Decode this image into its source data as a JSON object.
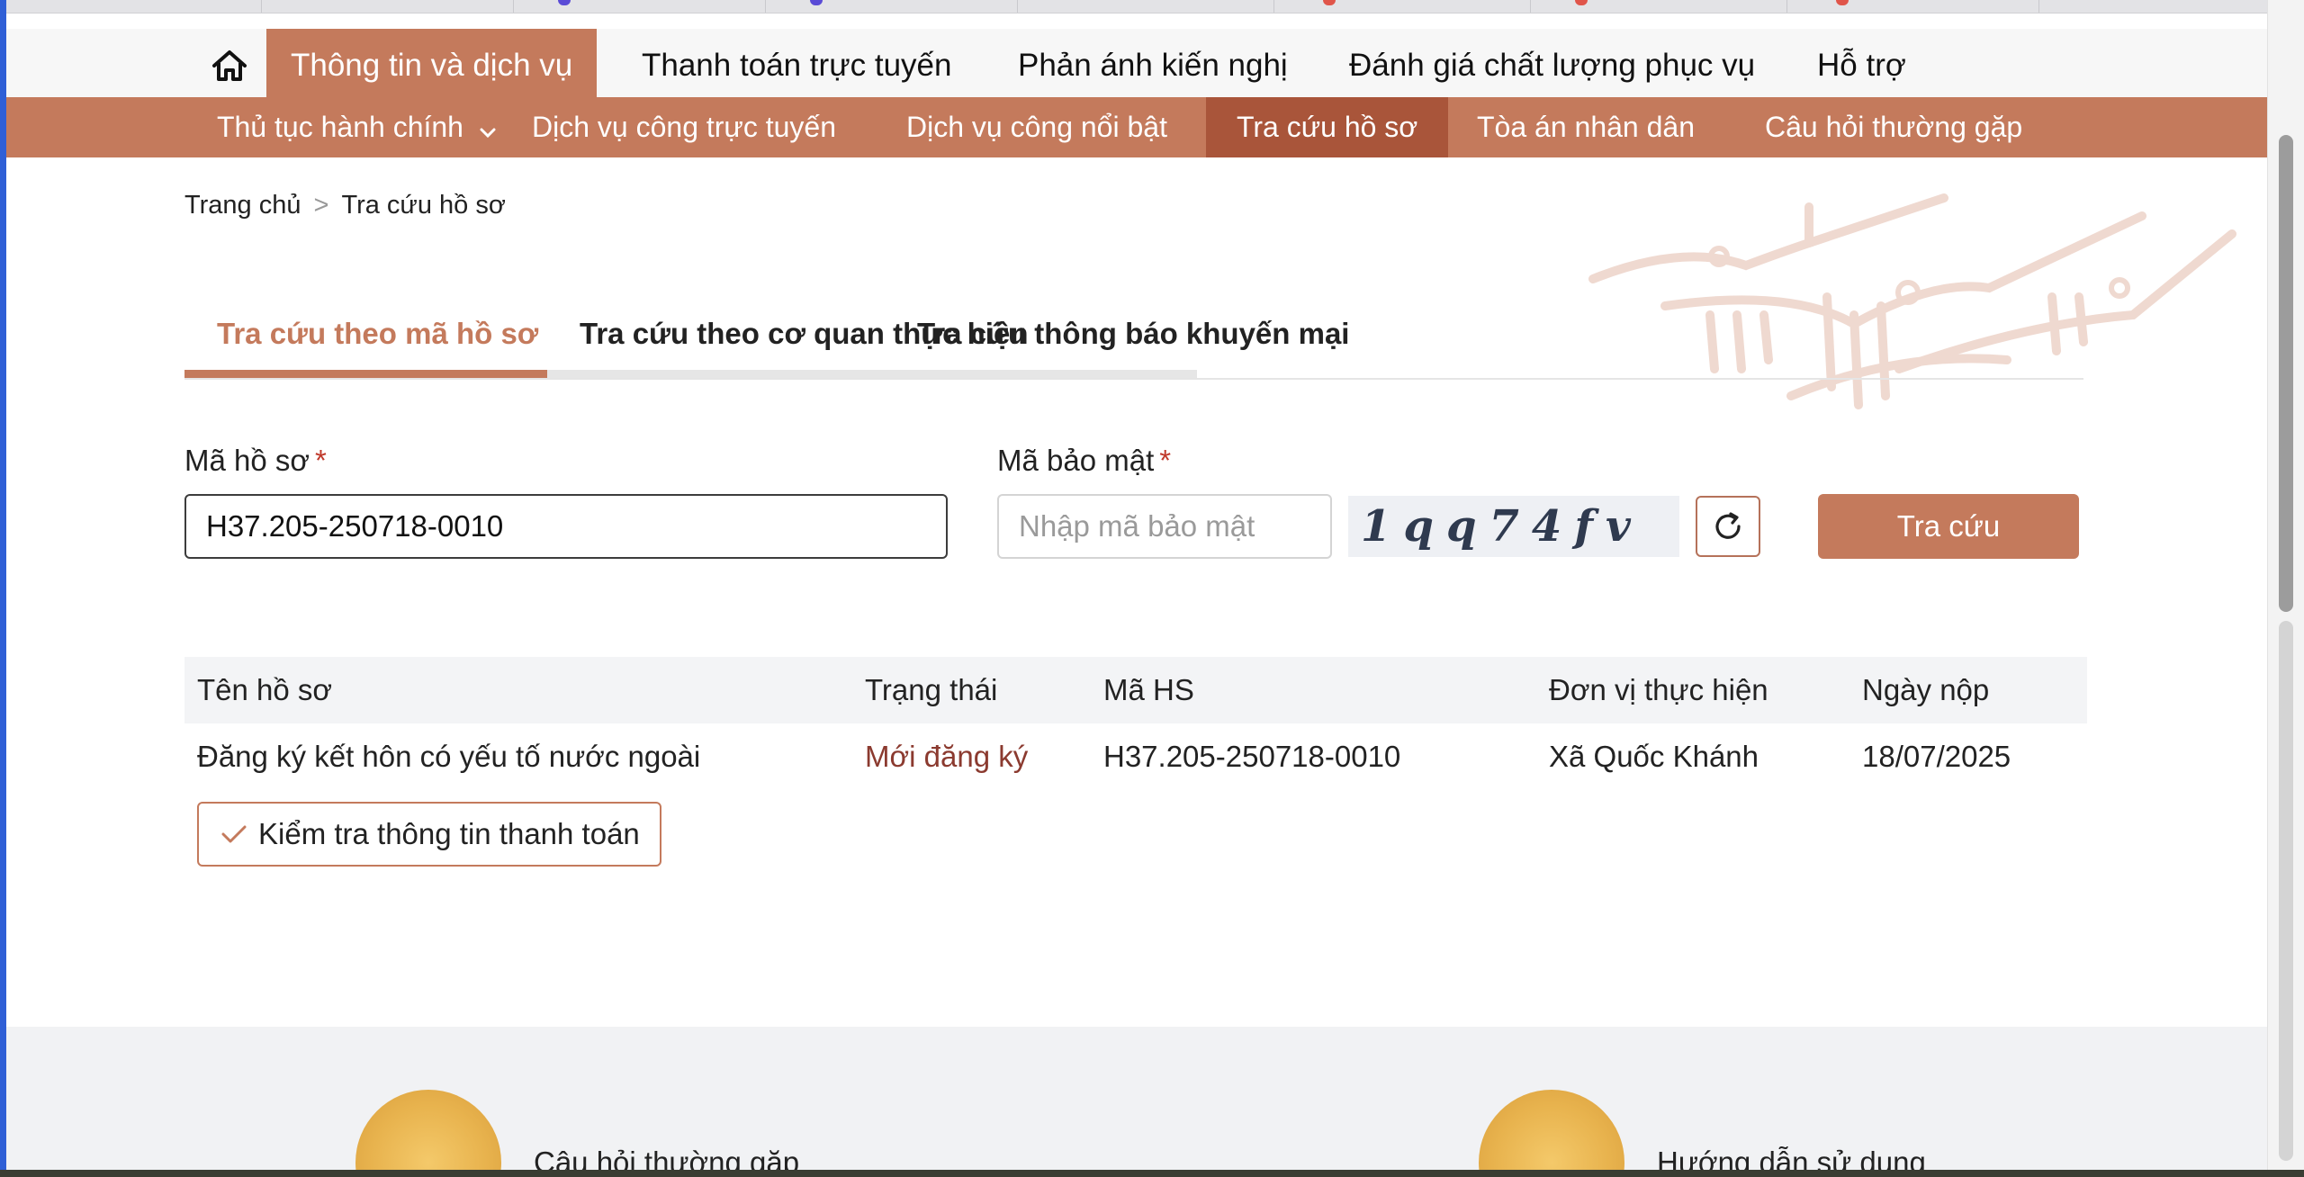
{
  "main_nav": {
    "home_icon": "home-icon",
    "items": [
      {
        "label": "Thông tin và dịch vụ"
      },
      {
        "label": "Thanh toán trực tuyến"
      },
      {
        "label": "Phản ánh kiến nghị"
      },
      {
        "label": "Đánh giá chất lượng phục vụ"
      },
      {
        "label": "Hỗ trợ"
      }
    ],
    "active_index": 0
  },
  "sub_nav": {
    "items": [
      {
        "label": "Thủ tục hành chính",
        "icon": "chevron-down-icon"
      },
      {
        "label": "Dịch vụ công trực tuyến"
      },
      {
        "label": "Dịch vụ công nổi bật"
      },
      {
        "label": "Tra cứu hồ sơ"
      },
      {
        "label": "Tòa án nhân dân"
      },
      {
        "label": "Câu hỏi thường gặp"
      }
    ],
    "active_index": 3
  },
  "breadcrumb": {
    "home": "Trang chủ",
    "separator": ">",
    "current": "Tra cứu hồ sơ"
  },
  "search_tabs": [
    {
      "label": "Tra cứu theo mã hồ sơ"
    },
    {
      "label": "Tra cứu theo cơ quan thực hiện"
    },
    {
      "label": "Tra cứu thông báo khuyến mại"
    }
  ],
  "form": {
    "hoso": {
      "label": "Mã hồ sơ",
      "required_mark": "*",
      "value": "H37.205-250718-0010"
    },
    "captcha": {
      "label": "Mã bảo mật",
      "required_mark": "*",
      "placeholder": "Nhập mã bảo mật",
      "image_text": "1qq74fv",
      "refresh_icon": "refresh-icon"
    },
    "search_button": "Tra cứu"
  },
  "results": {
    "columns": [
      "Tên hồ sơ",
      "Trạng thái",
      "Mã HS",
      "Đơn vị thực hiện",
      "Ngày nộp"
    ],
    "rows": [
      [
        "Đăng ký kết hôn có yếu tố nước ngoài",
        "Mới đăng ký",
        "H37.205-250718-0010",
        "Xã Quốc Khánh",
        "18/07/2025"
      ]
    ],
    "check_payment": {
      "label": "Kiểm tra thông tin thanh toán",
      "icon": "check-icon"
    }
  },
  "footer": {
    "links": [
      {
        "label": "Câu hỏi thường gặp",
        "icon": "emblem-icon"
      },
      {
        "label": "Hướng dẫn sử dụng",
        "icon": "emblem-icon"
      }
    ]
  },
  "colors": {
    "brand": "#c47a5c",
    "brand_dark": "#a9553a",
    "status": "#8b3a2f",
    "table_header_bg": "#f3f4f6"
  }
}
